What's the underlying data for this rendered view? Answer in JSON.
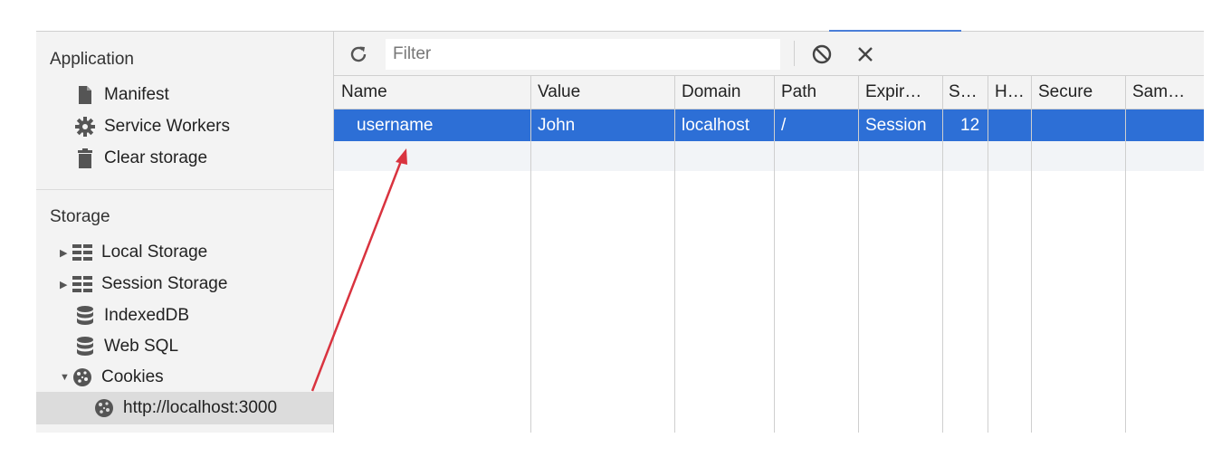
{
  "sidebar": {
    "application": {
      "title": "Application",
      "items": [
        {
          "label": "Manifest",
          "icon": "file-icon"
        },
        {
          "label": "Service Workers",
          "icon": "gear-icon"
        },
        {
          "label": "Clear storage",
          "icon": "trash-icon"
        }
      ]
    },
    "storage": {
      "title": "Storage",
      "items": [
        {
          "label": "Local Storage",
          "icon": "grid-icon",
          "expander": "collapsed"
        },
        {
          "label": "Session Storage",
          "icon": "grid-icon",
          "expander": "collapsed"
        },
        {
          "label": "IndexedDB",
          "icon": "database-icon"
        },
        {
          "label": "Web SQL",
          "icon": "database-icon"
        },
        {
          "label": "Cookies",
          "icon": "cookie-icon",
          "expander": "expanded"
        }
      ],
      "cookie_origin": "http://localhost:3000"
    }
  },
  "toolbar": {
    "filter_placeholder": "Filter",
    "refresh_icon": "refresh-icon",
    "clear_all_icon": "block-icon",
    "delete_icon": "close-icon"
  },
  "table": {
    "columns": [
      "Name",
      "Value",
      "Domain",
      "Path",
      "Expir…",
      "S…",
      "H…",
      "Secure",
      "Sam…"
    ],
    "rows": [
      [
        "username",
        "John",
        "localhost",
        "/",
        "Session",
        "12",
        "",
        "",
        ""
      ]
    ]
  },
  "colors": {
    "selection": "#2d6fd6",
    "annotation_arrow": "#d9333f",
    "tab_underline": "#4a7ed8"
  }
}
